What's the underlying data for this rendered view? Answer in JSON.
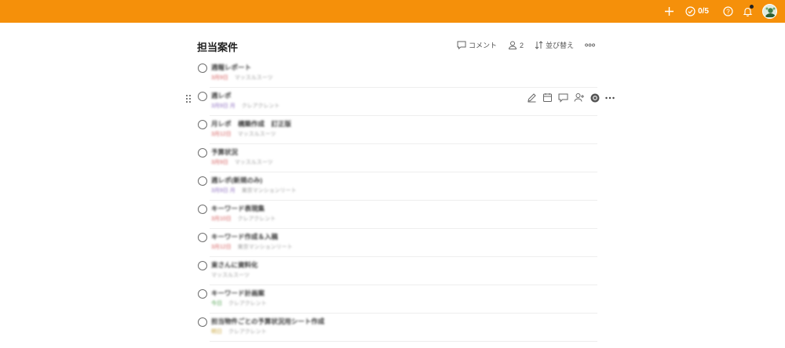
{
  "topbar": {
    "accent": "#f5900a",
    "progress_label": "0/5",
    "icons": [
      "plus-icon",
      "progress-check-icon",
      "help-icon",
      "bell-icon",
      "avatar"
    ]
  },
  "page": {
    "title": "担当案件",
    "comment_label": "コメント",
    "members_count": "2",
    "sort_label": "並び替え"
  },
  "tasks": [
    {
      "name": "週報レポート",
      "due": "3月9日",
      "project": "マッスルスーツ",
      "due_color": "red"
    },
    {
      "name": "週レポ",
      "due": "3月9日 月",
      "project": "クレアクレント",
      "due_color": "purple"
    },
    {
      "name": "月レポ　構築作成　訂正版",
      "due": "3月12日",
      "project": "マッスルスーツ",
      "due_color": "red"
    },
    {
      "name": "予算状況",
      "due": "3月9日",
      "project": "マッスルスーツ",
      "due_color": "red"
    },
    {
      "name": "週レポ(新規のみ)",
      "due": "3月9日 月",
      "project": "東京マンションリート",
      "due_color": "purple"
    },
    {
      "name": "キーワード表現集",
      "due": "3月10日",
      "project": "クレアクレント",
      "due_color": "red"
    },
    {
      "name": "キーワード作成＆入稿",
      "due": "3月12日",
      "project": "東京マンションリート",
      "due_color": "red"
    },
    {
      "name": "東さんに資料化",
      "due": "",
      "project": "マッスルスーツ",
      "due_color": "red"
    },
    {
      "name": "キーワード計画案",
      "due": "今日",
      "project": "クレアクレント",
      "due_color": "green"
    },
    {
      "name": "担当物件ごとの予算状況用シート作成",
      "due": "明日",
      "project": "クレアクレント",
      "due_color": "gold"
    }
  ]
}
